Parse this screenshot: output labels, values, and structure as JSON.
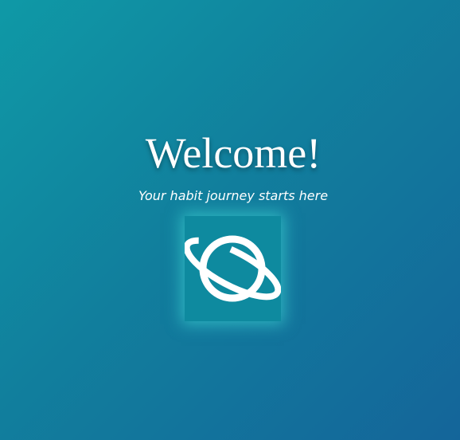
{
  "welcome": {
    "title": "Welcome!",
    "subtitle": "Your habit journey starts here",
    "logo_icon": "planet-icon"
  },
  "colors": {
    "background_start": "#0f99a6",
    "background_end": "#14659a",
    "logo_box": "#0e8a9f",
    "glow": "#46e6dc",
    "text": "#ffffff"
  }
}
